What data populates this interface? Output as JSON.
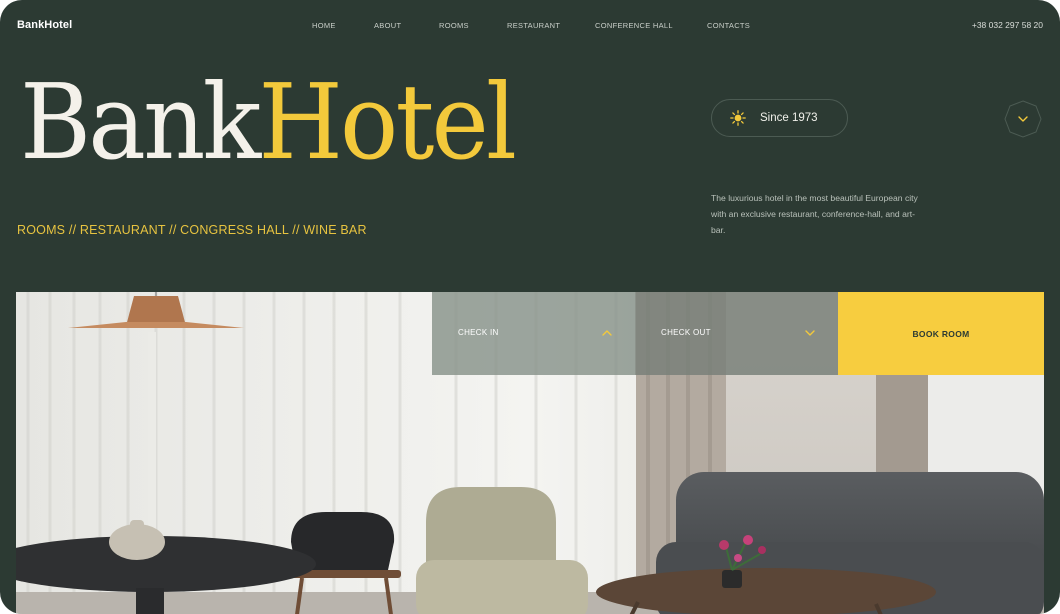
{
  "header": {
    "brand": "BankHotel",
    "nav": [
      "HOME",
      "ABOUT",
      "ROOMS",
      "RESTAURANT",
      "CONFERENCE HALL",
      "CONTACTS"
    ],
    "phone": "+38 032 297 58 20"
  },
  "hero": {
    "logo_part1": "Bank",
    "logo_part2": "Hotel",
    "tagline": "ROOMS // RESTAURANT // CONGRESS HALL // WINE BAR",
    "since": "Since 1973",
    "description": "The luxurious hotel in the most beautiful European city with an exclusive restaurant, conference-hall, and art-bar."
  },
  "booking": {
    "check_in": "CHECK IN",
    "check_out": "CHECK OUT",
    "book": "BOOK ROOM"
  },
  "icons": {
    "since": "sun-icon",
    "scroll": "chevron-down-icon",
    "check_in": "chevron-up-icon",
    "check_out": "chevron-down-icon"
  },
  "colors": {
    "background": "#2c3a33",
    "accent": "#f3c93b",
    "book_button": "#f7cd3f"
  }
}
